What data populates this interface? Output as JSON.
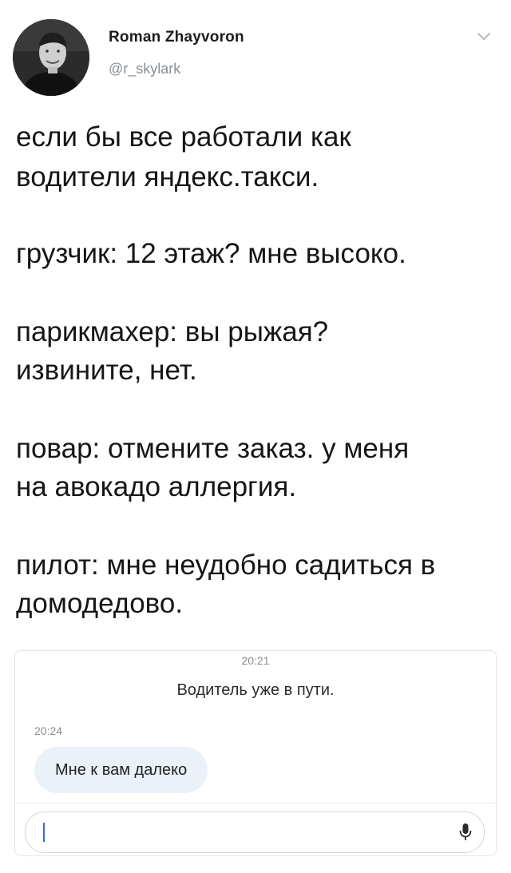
{
  "header": {
    "name": "Roman Zhayvoron",
    "handle": "@r_skylark"
  },
  "tweet": {
    "line1": "если бы все работали как",
    "line2": "водители яндекс.такси.",
    "line3": "грузчик: 12 этаж? мне высоко.",
    "line4": "парикмахер: вы рыжая?",
    "line5": "извините, нет.",
    "line6": "повар: отмените заказ. у меня",
    "line7": "на авокадо аллергия.",
    "line8": "пилот: мне неудобно садиться в",
    "line9": "домодедово."
  },
  "chat": {
    "time1": "20:21",
    "system_message": "Водитель уже в пути.",
    "time2": "20:24",
    "message": "Мне к вам далеко"
  },
  "icons": {
    "menu": "chevron-down-icon",
    "input": "microphone-icon"
  },
  "colors": {
    "handle": "#8a8f94",
    "bubble": "#eaf1f9",
    "cursor": "#2f6fd8"
  }
}
